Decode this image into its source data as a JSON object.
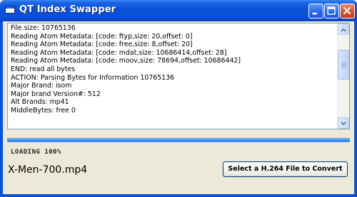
{
  "window": {
    "title": "QT Index Swapper",
    "controls": [
      "minimize-icon",
      "maximize-icon",
      "close-icon"
    ]
  },
  "log": {
    "lines": [
      "File.size: 10765136",
      "Reading Atom Metadata: [code: ftyp,size: 20,offset: 0]",
      "Reading Atom Metadata: [code: free,size: 8,offset: 20]",
      "Reading Atom Metadata: [code: mdat,size: 10686414,offset: 28]",
      "Reading Atom Metadata: [code: moov,size: 78694,offset: 10686442]",
      "END: read all bytes",
      "ACTION: Parsing Bytes for Information 10765136",
      "Major Brand: isom",
      "Major brand Version#: 512",
      "Alt Brands: mp41",
      "MiddleBytes: free 0",
      ""
    ]
  },
  "progress": {
    "value": 1.0
  },
  "status": {
    "loading_text": "LOADING 100%"
  },
  "file": {
    "name": "X-Men-700.mp4"
  },
  "actions": {
    "convert_label": "Select a H.264 File to Convert"
  },
  "colors": {
    "titlebar": "#0a52d8",
    "client": "#ece9d8",
    "progress": "#2d8ef5",
    "close": "#e0552e"
  }
}
